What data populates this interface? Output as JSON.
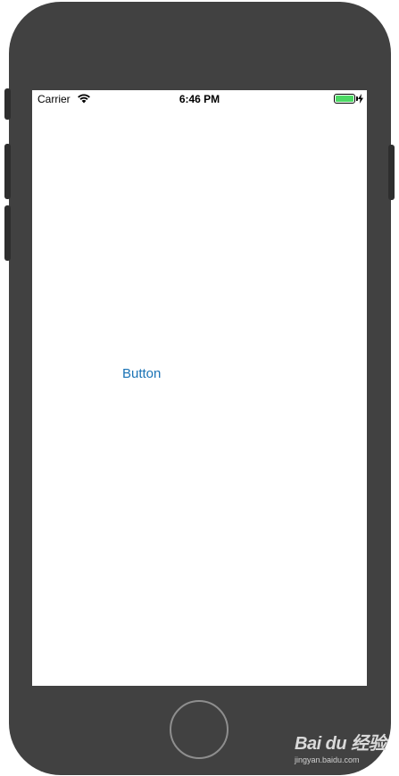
{
  "status_bar": {
    "carrier": "Carrier",
    "time": "6:46 PM",
    "battery_color": "#4cd964",
    "wifi_icon": "wifi-icon",
    "charging_icon": "bolt-icon"
  },
  "main": {
    "button_label": "Button",
    "button_color": "#1a73b5"
  },
  "watermark": {
    "logo": "Bai du 经验",
    "url": "jingyan.baidu.com"
  }
}
